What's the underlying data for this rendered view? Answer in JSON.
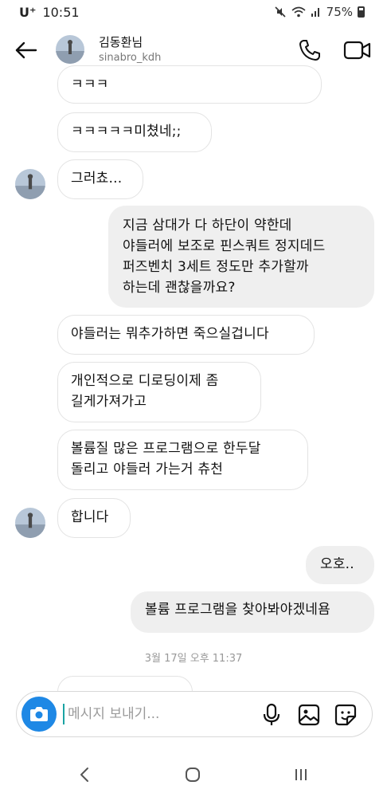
{
  "status_bar": {
    "carrier": "U⁺",
    "time": "10:51",
    "battery": "75%",
    "icons": [
      "mute-icon",
      "wifi-icon",
      "signal-icon",
      "battery-icon"
    ]
  },
  "header": {
    "name": "김동환님",
    "username": "sinabro_kdh"
  },
  "messages": [
    {
      "dir": "in",
      "text": "ㅋㅋㅋ"
    },
    {
      "dir": "in",
      "text": "ㅋㅋㅋㅋㅋ미쳤네;;"
    },
    {
      "dir": "in",
      "text": "그러쵸..."
    },
    {
      "dir": "out",
      "text": "지금 삼대가 다 하단이 약한데\n야들러에 보조로 핀스쿼트 정지데드\n퍼즈벤치 3세트 정도만 추가할까\n하는데 괜찮을까요?"
    },
    {
      "dir": "in",
      "text": "야들러는 뭐추가하면 죽으실겁니다"
    },
    {
      "dir": "in",
      "text": "개인적으로 디로딩이제 좀\n길게가져가고"
    },
    {
      "dir": "in",
      "text": "볼륨질 많은 프로그램으로 한두달\n돌리고 야들러 가는거 츄천"
    },
    {
      "dir": "in",
      "text": "합니다"
    },
    {
      "dir": "out",
      "text": "오호.."
    },
    {
      "dir": "out",
      "text": "볼륨 프로그램을 찾아봐야겠네욤"
    }
  ],
  "timestamp": "3월 17일 오후 11:37",
  "composer": {
    "placeholder": "메시지 보내기..."
  },
  "colors": {
    "accent": "#1e88e5",
    "outgoing_bubble": "#efefef",
    "incoming_border": "#e3e3e3"
  }
}
